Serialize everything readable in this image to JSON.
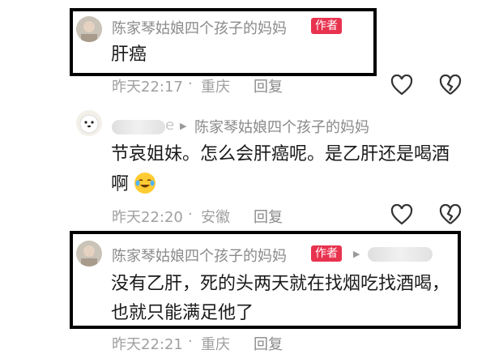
{
  "comments": [
    {
      "author": "陈家琴姑娘四个孩子的妈妈",
      "badge": "作者",
      "text": "肝癌",
      "time": "昨天22:17",
      "location": "重庆",
      "reply": "回复"
    },
    {
      "author_blurred": "e",
      "reply_to": "陈家琴姑娘四个孩子的妈妈",
      "text_line1": "节哀姐妹。怎么会肝癌呢。是乙肝还是喝酒",
      "text_line2": "啊",
      "emoji": "crying-laughing-emoji",
      "time": "昨天22:20",
      "location": "安徽",
      "reply": "回复"
    },
    {
      "author": "陈家琴姑娘四个孩子的妈妈",
      "badge": "作者",
      "text_line1": "没有乙肝，死的头两天就在找烟吃找酒喝，",
      "text_line2": "也就只能满足他了",
      "time": "昨天22:21",
      "location": "重庆",
      "reply": "回复"
    }
  ],
  "colors": {
    "badge": "#e8334f",
    "meta_text": "#a0a0a0",
    "frame": "#000000"
  },
  "icons": [
    "heart-icon",
    "broken-heart-icon",
    "reply-arrow-icon"
  ]
}
